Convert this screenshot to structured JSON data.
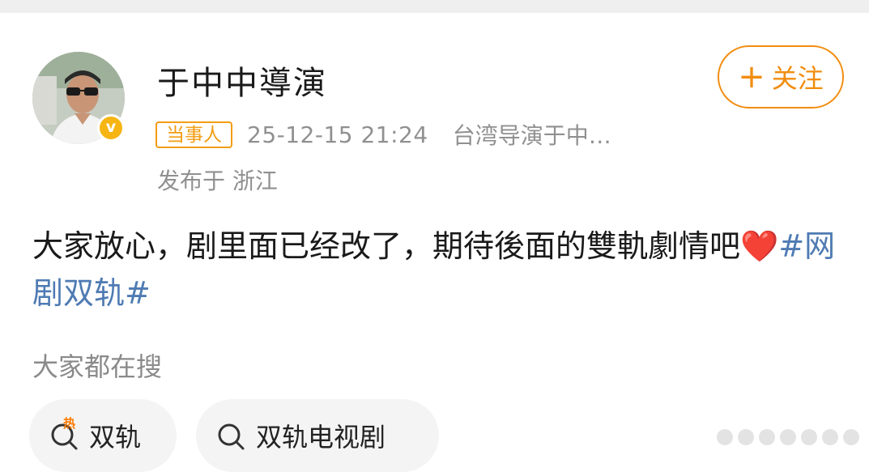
{
  "author": {
    "name": "于中中導演",
    "verified": true,
    "follow_label": "关注",
    "follow_plus": "+"
  },
  "meta": {
    "role_badge": "当事人",
    "timestamp": "25-12-15 21:24",
    "source": "台湾导演于中…",
    "location": "发布于 浙江"
  },
  "post": {
    "text": "大家放心，剧里面已经改了，期待後面的雙軌劇情吧",
    "emoji": "❤️",
    "hashtag": "#网剧双轨#"
  },
  "search_section": {
    "label": "大家都在搜",
    "hot_tag": "热",
    "chips": [
      {
        "label": "双轨",
        "hot": true
      },
      {
        "label": "双轨电视剧",
        "hot": false
      }
    ]
  },
  "colors": {
    "accent_orange": "#f18d0f",
    "link_blue": "#4f7bb3",
    "verified_yellow": "#f6b513",
    "meta_gray": "#909090"
  }
}
